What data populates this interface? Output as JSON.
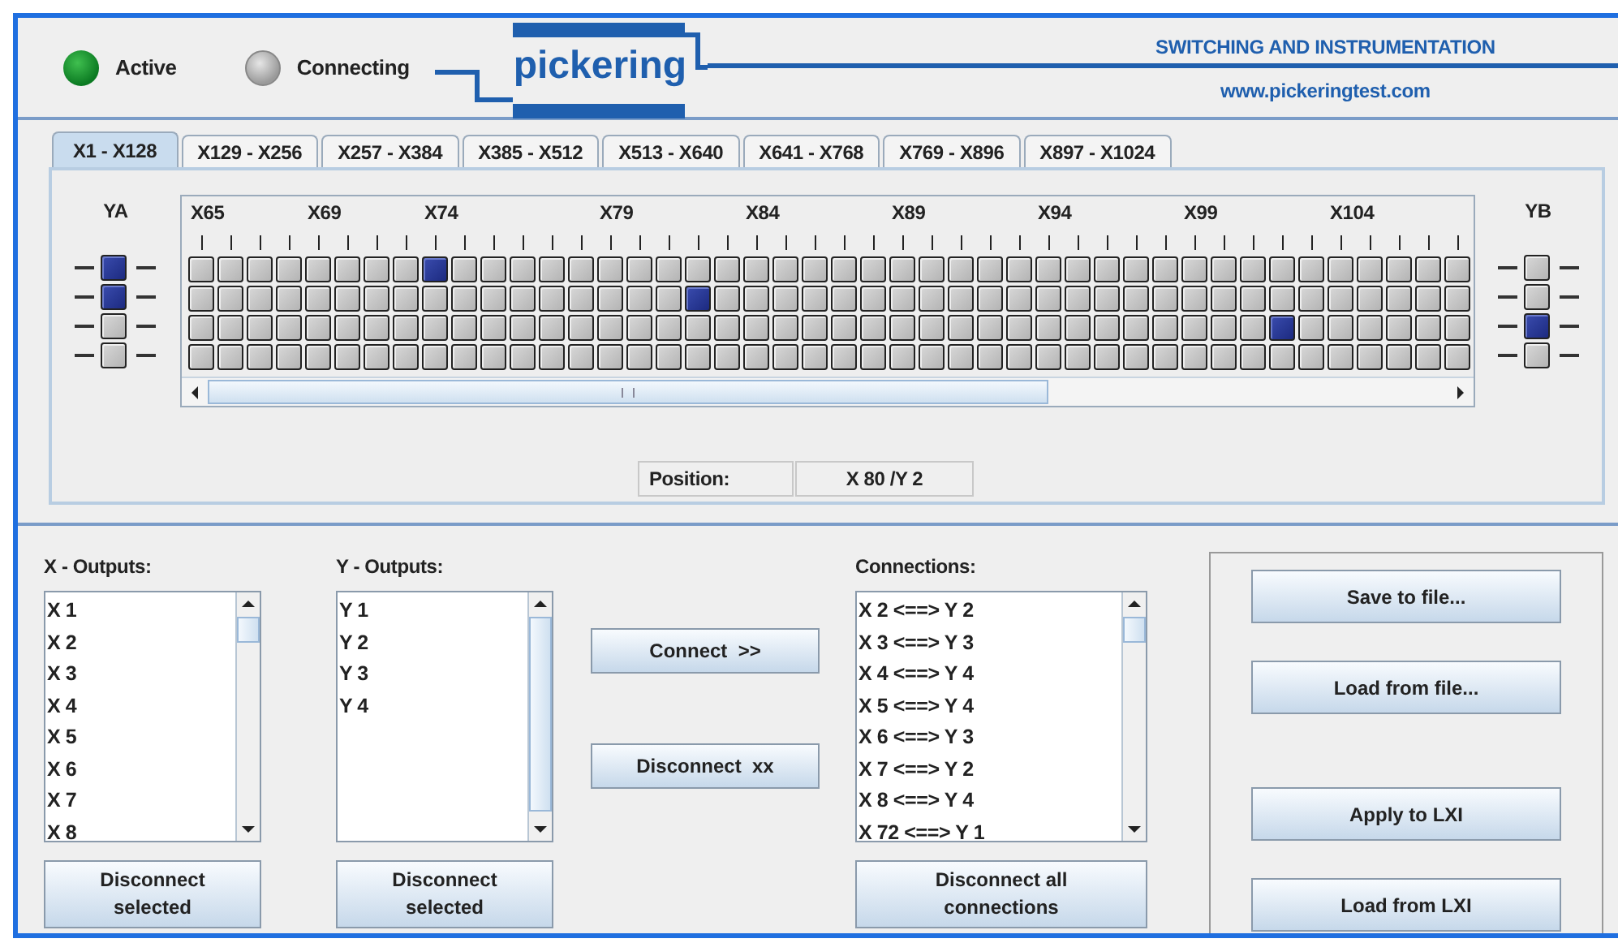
{
  "header": {
    "status_indicators": [
      {
        "label": "Active",
        "on": true
      },
      {
        "label": "Connecting",
        "on": false
      }
    ],
    "logo": "pickering",
    "tagline": "SWITCHING AND INSTRUMENTATION",
    "website": "www.pickeringtest.com"
  },
  "tabs": [
    {
      "label": "X1 - X128",
      "selected": true
    },
    {
      "label": "X129 - X256",
      "selected": false
    },
    {
      "label": "X257 - X384",
      "selected": false
    },
    {
      "label": "X385 - X512",
      "selected": false
    },
    {
      "label": "X513 - X640",
      "selected": false
    },
    {
      "label": "X641 - X768",
      "selected": false
    },
    {
      "label": "X769 - X896",
      "selected": false
    },
    {
      "label": "X897 - X1024",
      "selected": false
    }
  ],
  "matrix": {
    "y_left": {
      "label": "YA",
      "closed": [
        true,
        true,
        false,
        false
      ]
    },
    "y_right": {
      "label": "YB",
      "closed": [
        false,
        false,
        true,
        false
      ]
    },
    "columns": [
      {
        "label": "X65",
        "closed": [
          false,
          false,
          false,
          false
        ]
      },
      {
        "closed": [
          false,
          false,
          false,
          false
        ]
      },
      {
        "closed": [
          false,
          false,
          false,
          false
        ]
      },
      {
        "closed": [
          false,
          false,
          false,
          false
        ]
      },
      {
        "label": "X69",
        "closed": [
          false,
          false,
          false,
          false
        ]
      },
      {
        "closed": [
          false,
          false,
          false,
          false
        ]
      },
      {
        "closed": [
          false,
          false,
          false,
          false
        ]
      },
      {
        "closed": [
          false,
          false,
          false,
          false
        ]
      },
      {
        "label": "X74",
        "closed": [
          true,
          false,
          false,
          false
        ]
      },
      {
        "closed": [
          false,
          false,
          false,
          false
        ]
      },
      {
        "closed": [
          false,
          false,
          false,
          false
        ]
      },
      {
        "closed": [
          false,
          false,
          false,
          false
        ]
      },
      {
        "closed": [
          false,
          false,
          false,
          false
        ]
      },
      {
        "closed": [
          false,
          false,
          false,
          false
        ]
      },
      {
        "label": "X79",
        "closed": [
          false,
          false,
          false,
          false
        ]
      },
      {
        "closed": [
          false,
          false,
          false,
          false
        ]
      },
      {
        "closed": [
          false,
          false,
          false,
          false
        ]
      },
      {
        "closed": [
          false,
          true,
          false,
          false
        ]
      },
      {
        "closed": [
          false,
          false,
          false,
          false
        ]
      },
      {
        "label": "X84",
        "closed": [
          false,
          false,
          false,
          false
        ]
      },
      {
        "closed": [
          false,
          false,
          false,
          false
        ]
      },
      {
        "closed": [
          false,
          false,
          false,
          false
        ]
      },
      {
        "closed": [
          false,
          false,
          false,
          false
        ]
      },
      {
        "closed": [
          false,
          false,
          false,
          false
        ]
      },
      {
        "label": "X89",
        "closed": [
          false,
          false,
          false,
          false
        ]
      },
      {
        "closed": [
          false,
          false,
          false,
          false
        ]
      },
      {
        "closed": [
          false,
          false,
          false,
          false
        ]
      },
      {
        "closed": [
          false,
          false,
          false,
          false
        ]
      },
      {
        "closed": [
          false,
          false,
          false,
          false
        ]
      },
      {
        "label": "X94",
        "closed": [
          false,
          false,
          false,
          false
        ]
      },
      {
        "closed": [
          false,
          false,
          false,
          false
        ]
      },
      {
        "closed": [
          false,
          false,
          false,
          false
        ]
      },
      {
        "closed": [
          false,
          false,
          false,
          false
        ]
      },
      {
        "closed": [
          false,
          false,
          false,
          false
        ]
      },
      {
        "label": "X99",
        "closed": [
          false,
          false,
          false,
          false
        ]
      },
      {
        "closed": [
          false,
          false,
          false,
          false
        ]
      },
      {
        "closed": [
          false,
          false,
          false,
          false
        ]
      },
      {
        "closed": [
          false,
          false,
          true,
          false
        ]
      },
      {
        "closed": [
          false,
          false,
          false,
          false
        ]
      },
      {
        "label": "X104",
        "closed": [
          false,
          false,
          false,
          false
        ]
      },
      {
        "closed": [
          false,
          false,
          false,
          false
        ]
      },
      {
        "closed": [
          false,
          false,
          false,
          false
        ]
      },
      {
        "closed": [
          false,
          false,
          false,
          false
        ]
      },
      {
        "closed": [
          false,
          false,
          false,
          false
        ]
      }
    ]
  },
  "position": {
    "label": "Position:",
    "value": "X 80 /Y 2"
  },
  "x_outputs": {
    "label": "X - Outputs:",
    "items": [
      "X 1",
      "X 2",
      "X 3",
      "X 4",
      "X 5",
      "X 6",
      "X 7",
      "X 8"
    ],
    "button": "Disconnect selected"
  },
  "y_outputs": {
    "label": "Y - Outputs:",
    "items": [
      "Y 1",
      "Y 2",
      "Y 3",
      "Y 4"
    ],
    "button": "Disconnect selected"
  },
  "actions": [
    "Connect  >>",
    "Disconnect  xx"
  ],
  "connections": {
    "label": "Connections:",
    "items": [
      "X 2 <==> Y 2",
      "X 3 <==> Y 3",
      "X 4 <==> Y 4",
      "X 5 <==> Y 4",
      "X 6 <==> Y 3",
      "X 7 <==> Y 2",
      "X 8 <==> Y 4",
      "X 72 <==> Y 1"
    ],
    "button": "Disconnect all connections"
  },
  "file_buttons": [
    "Save to file...",
    "Load from file...",
    "Apply to LXI",
    "Load from LXI"
  ]
}
